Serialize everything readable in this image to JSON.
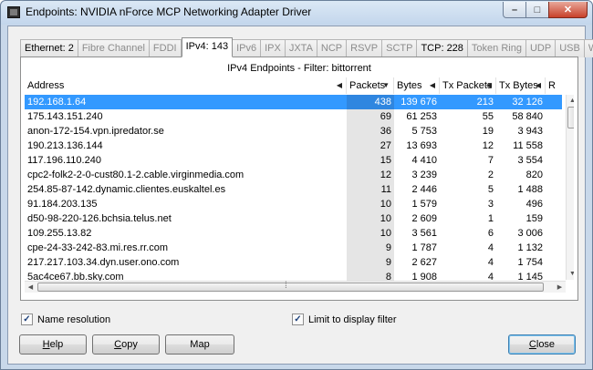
{
  "window": {
    "title": "Endpoints: NVIDIA nForce MCP Networking Adapter Driver",
    "controls": {
      "minimize": "–",
      "maximize": "□",
      "close": "✕"
    }
  },
  "tabs": [
    {
      "label": "Ethernet: 2",
      "state": "strong"
    },
    {
      "label": "Fibre Channel",
      "state": "dim"
    },
    {
      "label": "FDDI",
      "state": "dim"
    },
    {
      "label": "IPv4: 143",
      "state": "active"
    },
    {
      "label": "IPv6",
      "state": "dim"
    },
    {
      "label": "IPX",
      "state": "dim"
    },
    {
      "label": "JXTA",
      "state": "dim"
    },
    {
      "label": "NCP",
      "state": "dim"
    },
    {
      "label": "RSVP",
      "state": "dim"
    },
    {
      "label": "SCTP",
      "state": "dim"
    },
    {
      "label": "TCP: 228",
      "state": "strong"
    },
    {
      "label": "Token Ring",
      "state": "dim"
    },
    {
      "label": "UDP",
      "state": "dim"
    },
    {
      "label": "USB",
      "state": "dim"
    },
    {
      "label": "WLAN",
      "state": "dim"
    }
  ],
  "panel": {
    "title": "IPv4 Endpoints - Filter: bittorrent"
  },
  "table": {
    "columns": [
      {
        "key": "addr",
        "label": "Address",
        "arrow": "◀"
      },
      {
        "key": "pk",
        "label": "Packets",
        "arrow": "▼"
      },
      {
        "key": "by",
        "label": "Bytes",
        "arrow": "◀"
      },
      {
        "key": "tp",
        "label": "Tx Packets",
        "arrow": "◀"
      },
      {
        "key": "tb",
        "label": "Tx Bytes",
        "arrow": "◀"
      },
      {
        "key": "rx",
        "label": "R",
        "arrow": ""
      }
    ],
    "rows": [
      {
        "addr": "192.168.1.64",
        "pk": "438",
        "by": "139 676",
        "tp": "213",
        "tb": "32 126",
        "selected": true
      },
      {
        "addr": "175.143.151.240",
        "pk": "69",
        "by": "61 253",
        "tp": "55",
        "tb": "58 840"
      },
      {
        "addr": "anon-172-154.vpn.ipredator.se",
        "pk": "36",
        "by": "5 753",
        "tp": "19",
        "tb": "3 943"
      },
      {
        "addr": "190.213.136.144",
        "pk": "27",
        "by": "13 693",
        "tp": "12",
        "tb": "11 558"
      },
      {
        "addr": "117.196.110.240",
        "pk": "15",
        "by": "4 410",
        "tp": "7",
        "tb": "3 554"
      },
      {
        "addr": "cpc2-folk2-2-0-cust80.1-2.cable.virginmedia.com",
        "pk": "12",
        "by": "3 239",
        "tp": "2",
        "tb": "820"
      },
      {
        "addr": "254.85-87-142.dynamic.clientes.euskaltel.es",
        "pk": "11",
        "by": "2 446",
        "tp": "5",
        "tb": "1 488"
      },
      {
        "addr": "91.184.203.135",
        "pk": "10",
        "by": "1 579",
        "tp": "3",
        "tb": "496"
      },
      {
        "addr": "d50-98-220-126.bchsia.telus.net",
        "pk": "10",
        "by": "2 609",
        "tp": "1",
        "tb": "159"
      },
      {
        "addr": "109.255.13.82",
        "pk": "10",
        "by": "3 561",
        "tp": "6",
        "tb": "3 006"
      },
      {
        "addr": "cpe-24-33-242-83.mi.res.rr.com",
        "pk": "9",
        "by": "1 787",
        "tp": "4",
        "tb": "1 132"
      },
      {
        "addr": "217.217.103.34.dyn.user.ono.com",
        "pk": "9",
        "by": "2 627",
        "tp": "4",
        "tb": "1 754"
      },
      {
        "addr": "5ac4ce67.bb.sky.com",
        "pk": "8",
        "by": "1 908",
        "tp": "4",
        "tb": "1 145"
      }
    ]
  },
  "options": {
    "name_resolution": {
      "label": "Name resolution",
      "checked": true,
      "mark": "✓"
    },
    "limit_filter": {
      "label": "Limit to display filter",
      "checked": true,
      "mark": "✓"
    }
  },
  "buttons": {
    "help": {
      "label": "Help",
      "mnemonic_index": 0
    },
    "copy": {
      "label": "Copy",
      "mnemonic_index": 0
    },
    "map": {
      "label": "Map"
    },
    "close": {
      "label": "Close",
      "mnemonic_index": 0
    }
  },
  "icons": {
    "app": "wireshark-window-icon",
    "scroll_up": "▲",
    "scroll_down": "▼",
    "scroll_left": "◀",
    "scroll_right": "▶"
  }
}
